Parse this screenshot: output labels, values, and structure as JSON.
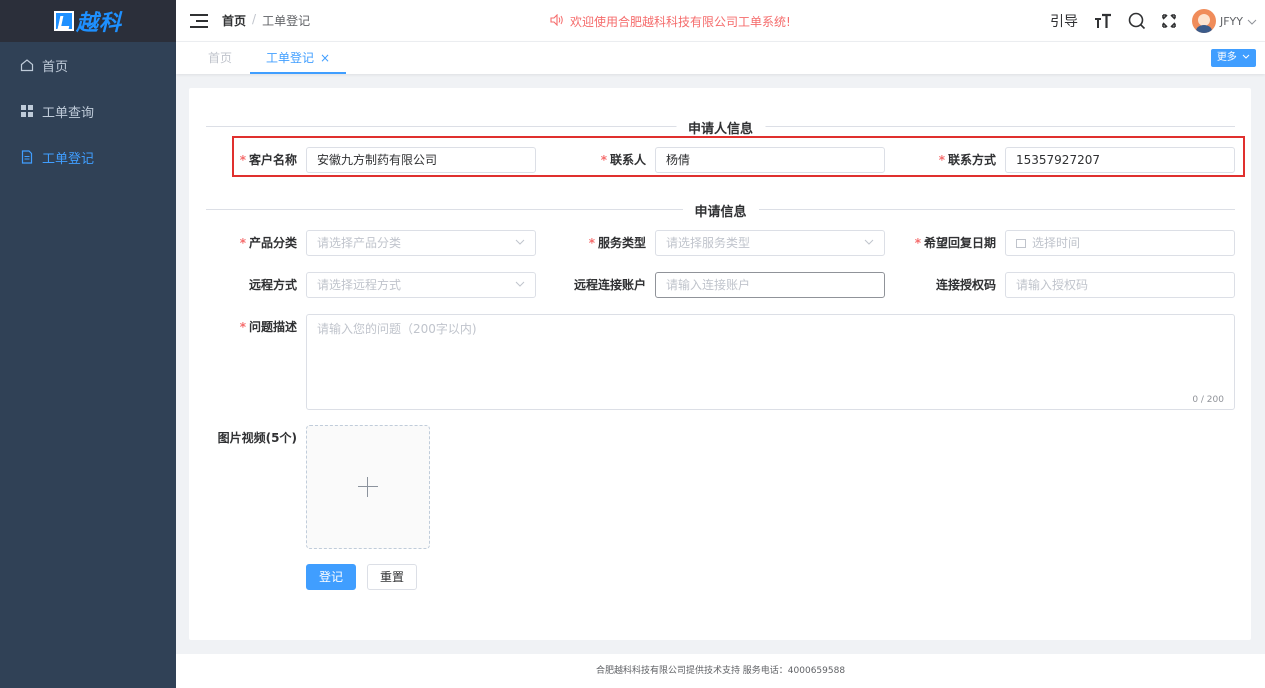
{
  "brand": {
    "logo_text": "越科",
    "color": "#1e90ff"
  },
  "sidebar": {
    "items": [
      {
        "label": "首页",
        "icon": "home-icon",
        "active": false
      },
      {
        "label": "工单查询",
        "icon": "grid-icon",
        "active": false
      },
      {
        "label": "工单登记",
        "icon": "document-icon",
        "active": true
      }
    ]
  },
  "navbar": {
    "breadcrumb": [
      "首页",
      "/",
      "工单登记"
    ],
    "announcement": "欢迎使用合肥越科科技有限公司工单系统!",
    "guide_label": "引导",
    "user_name": "JFYY"
  },
  "tags": {
    "items": [
      {
        "label": "首页",
        "active": false
      },
      {
        "label": "工单登记",
        "active": true,
        "close": "×"
      }
    ],
    "more_label": "更多"
  },
  "form": {
    "section_applicant": "申请人信息",
    "section_request": "申请信息",
    "customer_label": "客户名称",
    "customer_value": "安徽九方制药有限公司",
    "contact_label": "联系人",
    "contact_value": "杨倩",
    "phone_label": "联系方式",
    "phone_value": "15357927207",
    "product_label": "产品分类",
    "product_placeholder": "请选择产品分类",
    "service_label": "服务类型",
    "service_placeholder": "请选择服务类型",
    "date_label": "希望回复日期",
    "date_placeholder": "选择时间",
    "remote_label": "远程方式",
    "remote_placeholder": "请选择远程方式",
    "remote_account_label": "远程连接账户",
    "remote_account_placeholder": "请输入连接账户",
    "auth_label": "连接授权码",
    "auth_placeholder": "请输入授权码",
    "desc_label": "问题描述",
    "desc_placeholder": "请输入您的问题（200字以内)",
    "desc_counter": "0 / 200",
    "media_label": "图片视频(5个)",
    "submit_label": "登记",
    "reset_label": "重置",
    "required_mark": "*"
  },
  "footer": {
    "text": "合肥越科科技有限公司提供技术支持 服务电话：4000659588"
  },
  "colors": {
    "accent": "#409eff",
    "highlight_box": "#e0302e",
    "sidebar_bg": "#304156",
    "required": "#f56c6c"
  }
}
